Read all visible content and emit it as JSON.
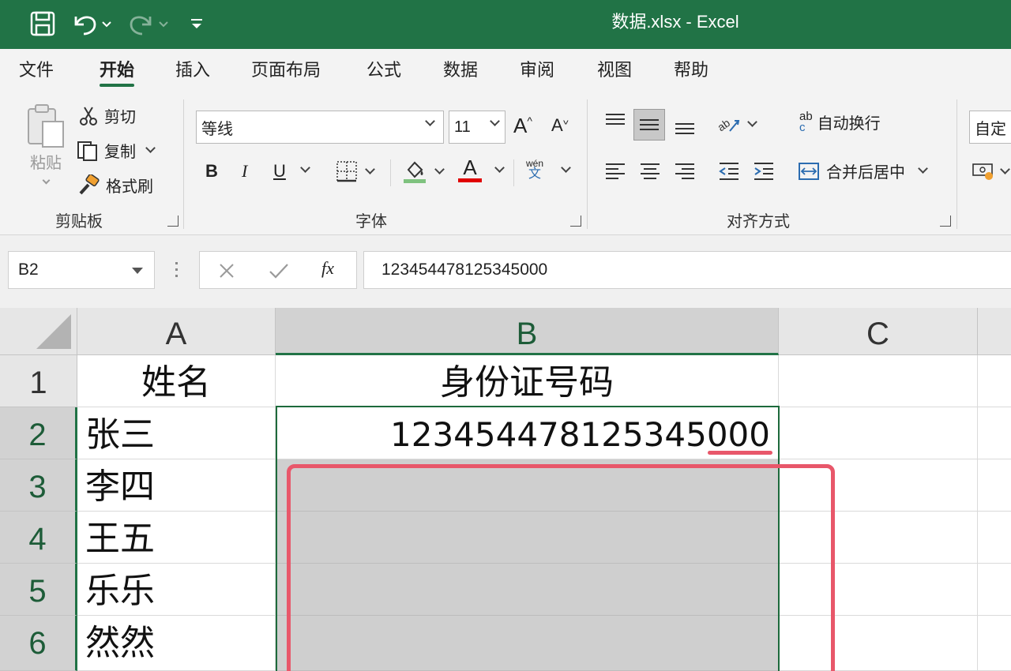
{
  "window": {
    "title": "数据.xlsx  -  Excel"
  },
  "tabs": [
    "文件",
    "开始",
    "插入",
    "页面布局",
    "公式",
    "数据",
    "审阅",
    "视图",
    "帮助"
  ],
  "clipboard": {
    "paste": "粘贴",
    "cut": "剪切",
    "copy": "复制",
    "format_painter": "格式刷",
    "group": "剪贴板"
  },
  "font": {
    "name": "等线",
    "size": "11",
    "grow": "A",
    "shrink": "A",
    "bold": "B",
    "italic": "I",
    "underline": "U",
    "font_color_glyph": "A",
    "phonetic_top": "wén",
    "phonetic_bottom": "文",
    "group": "字体"
  },
  "alignment": {
    "wrap": "自动换行",
    "merge": "合并后居中",
    "group": "对齐方式",
    "wrap_glyph_top": "ab",
    "wrap_glyph_bottom": "c"
  },
  "number": {
    "format": "自定"
  },
  "formula_bar": {
    "name_box": "B2",
    "fx": "fx",
    "value": "123454478125345000"
  },
  "sheet": {
    "columns": [
      "A",
      "B",
      "C"
    ],
    "rows": [
      "1",
      "2",
      "3",
      "4",
      "5",
      "6"
    ],
    "header": {
      "name": "姓名",
      "id": "身份证号码"
    },
    "names": [
      "张三",
      "李四",
      "王五",
      "乐乐",
      "然然"
    ],
    "id_b2": "123454478125345000"
  },
  "colors": {
    "excel_green": "#217346",
    "highlight_red": "#e8576a",
    "selection_gray": "#cfcfcf",
    "font_red": "#e00000",
    "fill_green": "#7fc27f"
  }
}
